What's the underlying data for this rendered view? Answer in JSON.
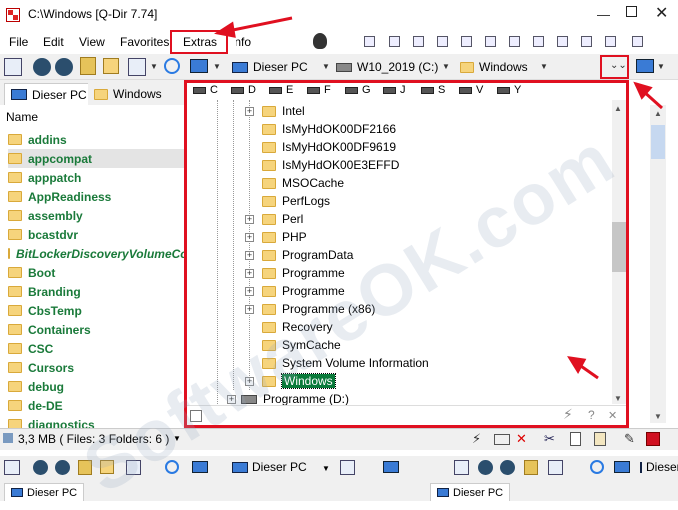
{
  "window": {
    "title": "C:\\Windows  [Q-Dir 7.74]",
    "min": "—",
    "close": "✕"
  },
  "menu": {
    "items": [
      "File",
      "Edit",
      "View",
      "Favorites",
      "Extras",
      "Info"
    ]
  },
  "toolbar": {
    "location": "Dieser PC",
    "drive": "W10_2019 (C:)",
    "folder": "Windows"
  },
  "tabs": {
    "left": [
      "Dieser PC",
      "Windows"
    ]
  },
  "leftpane": {
    "header": "Name",
    "items": [
      "addins",
      "appcompat",
      "apppatch",
      "AppReadiness",
      "assembly",
      "bcastdvr",
      "BitLockerDiscoveryVolumeContents",
      "Boot",
      "Branding",
      "CbsTemp",
      "Containers",
      "CSC",
      "Cursors",
      "debug",
      "de-DE",
      "diagnostics"
    ]
  },
  "drivebar": {
    "drives": [
      "C",
      "D",
      "E",
      "F",
      "G",
      "J",
      "S",
      "V",
      "Y"
    ]
  },
  "tree": {
    "items": [
      "Intel",
      "IsMyHdOK00DF2166",
      "IsMyHdOK00DF9619",
      "IsMyHdOK00E3EFFD",
      "MSOCache",
      "PerfLogs",
      "Perl",
      "PHP",
      "ProgramData",
      "Programme",
      "Programme",
      "Programme (x86)",
      "Recovery",
      "SymCache",
      "System Volume Information",
      "Windows",
      "Programme (D:)"
    ]
  },
  "statusbar": {
    "text": "3,3 MB ( Files: 3 Folders: 6 )"
  },
  "bottom": {
    "location1": "Dieser PC",
    "location2": "Dieser PC",
    "tab1": "Dieser PC",
    "tab2": "Dieser PC"
  },
  "watermark": "SoftwareOK.com",
  "colors": {
    "annotation": "#e01020",
    "folder_text": "#1a7a3a",
    "selection": "#0a7a3a"
  }
}
